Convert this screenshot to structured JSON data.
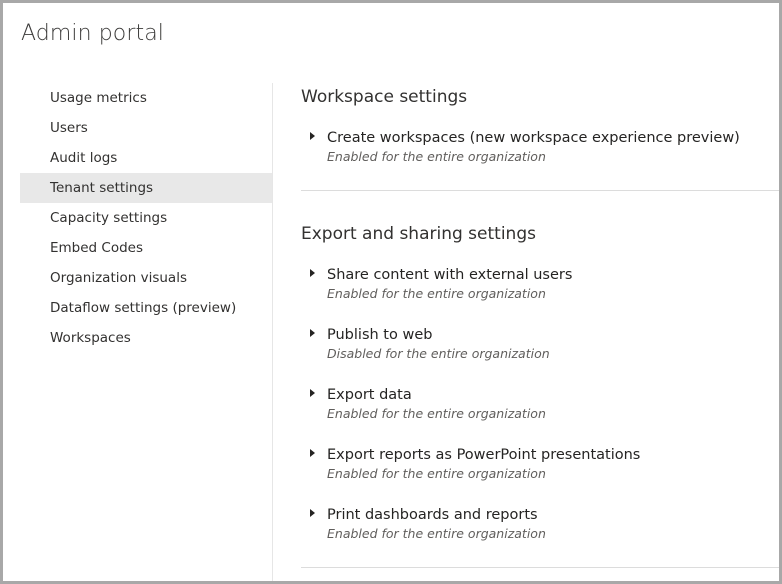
{
  "header": {
    "title": "Admin portal"
  },
  "sidebar": {
    "items": [
      {
        "label": "Usage metrics",
        "active": false
      },
      {
        "label": "Users",
        "active": false
      },
      {
        "label": "Audit logs",
        "active": false
      },
      {
        "label": "Tenant settings",
        "active": true
      },
      {
        "label": "Capacity settings",
        "active": false
      },
      {
        "label": "Embed Codes",
        "active": false
      },
      {
        "label": "Organization visuals",
        "active": false
      },
      {
        "label": "Dataflow settings (preview)",
        "active": false
      },
      {
        "label": "Workspaces",
        "active": false
      }
    ]
  },
  "main": {
    "sections": [
      {
        "title": "Workspace settings",
        "settings": [
          {
            "name": "Create workspaces (new workspace experience preview)",
            "status": "Enabled for the entire organization"
          }
        ]
      },
      {
        "title": "Export and sharing settings",
        "settings": [
          {
            "name": "Share content with external users",
            "status": "Enabled for the entire organization"
          },
          {
            "name": "Publish to web",
            "status": "Disabled for the entire organization"
          },
          {
            "name": "Export data",
            "status": "Enabled for the entire organization"
          },
          {
            "name": "Export reports as PowerPoint presentations",
            "status": "Enabled for the entire organization"
          },
          {
            "name": "Print dashboards and reports",
            "status": "Enabled for the entire organization"
          }
        ]
      }
    ]
  },
  "icons": {
    "expand": "caret-right-icon"
  },
  "colors": {
    "active_item_bg": "#e8e8e8",
    "frame_border": "#a8a8a8",
    "status_text": "#605e5c"
  }
}
